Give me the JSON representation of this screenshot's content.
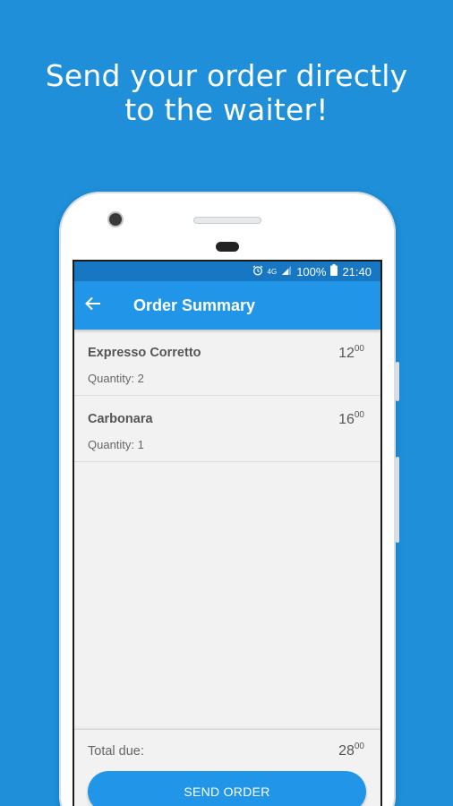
{
  "headline": {
    "line1": "Send your order directly",
    "line2": "to the waiter!"
  },
  "statusbar": {
    "alarm_icon": "alarm-clock-icon",
    "network": "4G",
    "signal_icon": "cellular-signal-icon",
    "battery_percent": "100%",
    "battery_icon": "battery-full-icon",
    "time": "21:40"
  },
  "appbar": {
    "back_icon": "arrow-left-icon",
    "title": "Order Summary"
  },
  "items": [
    {
      "name": "Expresso Corretto",
      "quantity": "Quantity: 2",
      "price_int": "12",
      "price_dec": "00"
    },
    {
      "name": "Carbonara",
      "quantity": "Quantity: 1",
      "price_int": "16",
      "price_dec": "00"
    }
  ],
  "footer": {
    "total_label": "Total due:",
    "total_int": "28",
    "total_dec": "00",
    "send_label": "SEND ORDER"
  },
  "colors": {
    "background": "#1E8FD8",
    "appbar": "#2196E9",
    "statusbar": "#1877C2",
    "button": "#2196E9"
  }
}
